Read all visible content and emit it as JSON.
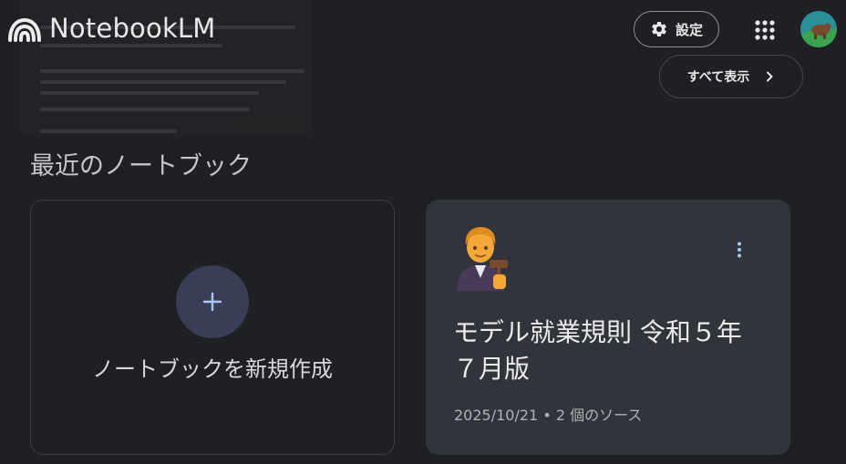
{
  "app": {
    "name": "NotebookLM"
  },
  "header": {
    "settings_label": "設定",
    "apps_icon": "apps-grid-icon",
    "avatar_icon": "user-avatar"
  },
  "recent": {
    "section_title": "最近のノートブック",
    "show_all_label": "すべて表示",
    "new_notebook_label": "ノートブックを新規作成",
    "notebooks": [
      {
        "emoji": "judge",
        "title": "モデル就業規則 令和５年７月版",
        "date": "2025/10/21",
        "sources": "2 個のソース",
        "separator": "•"
      }
    ]
  },
  "colors": {
    "background": "#1f2023",
    "card": "#31343b",
    "accent_circle": "#393d55",
    "accent_plus": "#a8c7fa"
  }
}
